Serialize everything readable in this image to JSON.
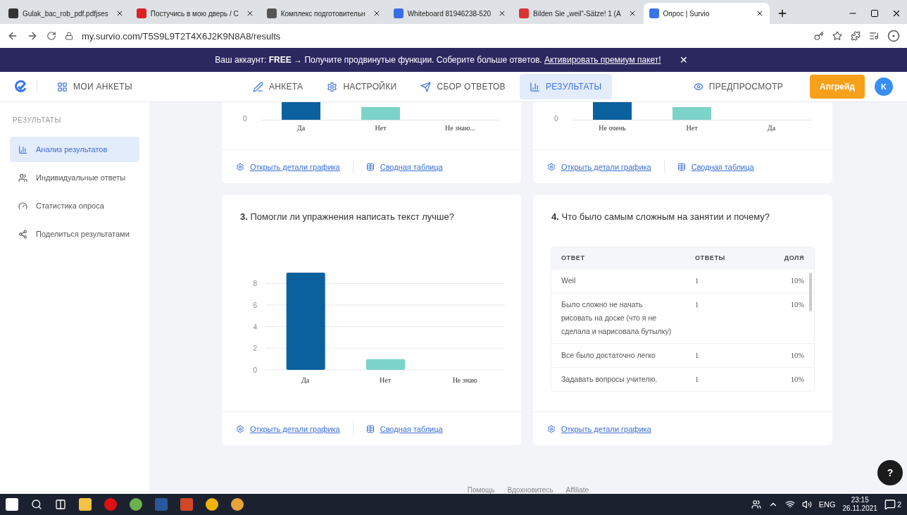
{
  "browser": {
    "tabs": [
      {
        "title": "Gulak_bac_rob_pdf.pdfjses",
        "selected": false
      },
      {
        "title": "Постучись в мою дверь / С",
        "selected": false
      },
      {
        "title": "Комплекс подготовительн",
        "selected": false
      },
      {
        "title": "Whiteboard 81946238-520",
        "selected": false
      },
      {
        "title": "Bilden Sie „weil“-Sätze! 1 (A",
        "selected": false
      },
      {
        "title": "Опрос | Survio",
        "selected": true
      }
    ],
    "address": "my.survio.com/T5S9L9T2T4X6J2K9N8A8/results"
  },
  "banner": {
    "text": "Ваш аккаунт: **FREE** → Получите продвинутые функции. Соберите больше ответов.",
    "link": "Активировать премиум пакет!",
    "close": "✕"
  },
  "nav": {
    "my_surveys": "МОИ АНКЕТЫ",
    "tabs": [
      {
        "label": "АНКЕТА",
        "selected": false
      },
      {
        "label": "НАСТРОЙКИ",
        "selected": false
      },
      {
        "label": "СБОР ОТВЕТОВ",
        "selected": false
      },
      {
        "label": "РЕЗУЛЬТАТЫ",
        "selected": true
      }
    ],
    "preview": "ПРЕДПРОСМОТР",
    "upgrade": "Апгрейд",
    "avatar": "K"
  },
  "sidebar": {
    "heading": "РЕЗУЛЬТАТЫ",
    "items": [
      {
        "label": "Анализ результатов",
        "selected": true
      },
      {
        "label": "Индивидуальные ответы",
        "selected": false
      },
      {
        "label": "Статистика опроса",
        "selected": false
      },
      {
        "label": "Поделиться результатами",
        "selected": false
      }
    ]
  },
  "top_cards": [
    {
      "zero_tick": "0",
      "categories": [
        {
          "label": "Да",
          "color": "#0b609e"
        },
        {
          "label": "Нет",
          "color": "#7bd3c9"
        },
        {
          "label": "Не знаю..."
        }
      ],
      "links": [
        "Открыть детали графика",
        "Сводная таблица"
      ]
    },
    {
      "zero_tick": "0",
      "categories": [
        {
          "label": "Не очень",
          "color": "#0b609e"
        },
        {
          "label": "Нет",
          "color": "#7bd3c9"
        },
        {
          "label": "Да"
        }
      ],
      "links": [
        "Открыть детали графика",
        "Сводная таблица"
      ]
    }
  ],
  "question3": {
    "number": "3.",
    "title": "Помогли ли упражнения написать текст лучше?",
    "chart_data": {
      "type": "bar",
      "grid": true,
      "yticks": [
        0,
        2,
        4,
        6,
        8
      ],
      "ylim": [
        0,
        9
      ],
      "series": [
        {
          "name": "Да",
          "color": "#0b609e",
          "values": [
            9
          ]
        },
        {
          "name": "Нет",
          "color": "#7bd3c9",
          "values": [
            1
          ]
        },
        {
          "name": "Не знаю",
          "values": [
            0
          ]
        }
      ]
    },
    "links": [
      "Открыть детали графика",
      "Сводная таблица"
    ]
  },
  "question4": {
    "number": "4.",
    "title": "Что было самым сложным на занятии и почему?",
    "table": {
      "columns": [
        "ОТВЕТ",
        "ОТВЕТЫ",
        "ДОЛЯ"
      ],
      "rows": [
        [
          "Weil",
          "1",
          "10%"
        ],
        [
          "Было сложно не начать рисовать на доске (что я не сделала и нарисовала бутылку)",
          "1",
          "10%"
        ],
        [
          "Все было достаточно легко",
          "1",
          "10%"
        ],
        [
          "Задавать вопросы учителю.",
          "1",
          "10%"
        ]
      ]
    },
    "links": [
      "Открыть детали графика"
    ]
  },
  "footer": [
    "Помощь",
    "Вдохновитесь",
    "Affiliate"
  ],
  "help": "?",
  "taskbar": {
    "lang": "ENG",
    "time": "23:15",
    "date": "26.11.2021",
    "notifications": "2"
  }
}
